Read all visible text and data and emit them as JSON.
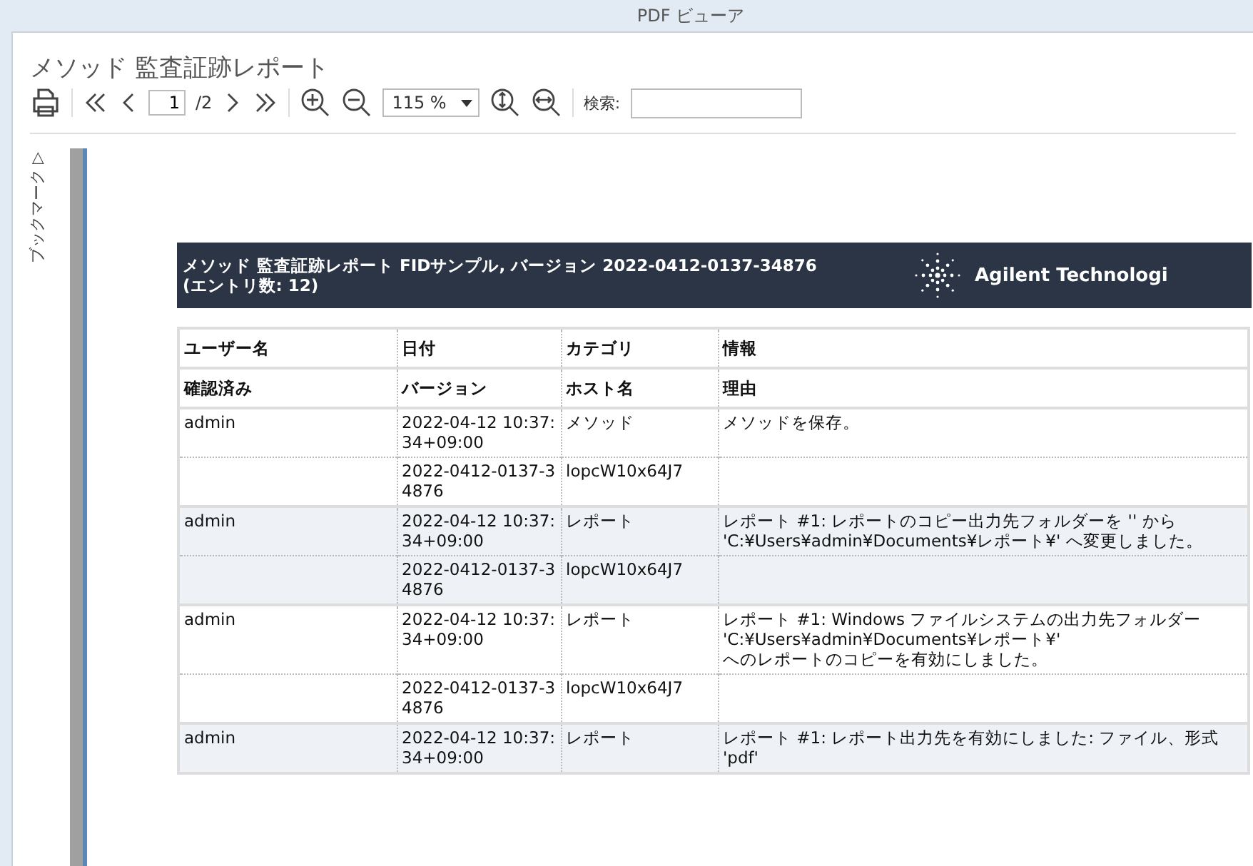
{
  "window": {
    "title": "PDF ビューア"
  },
  "document_title": "メソッド 監査証跡レポート",
  "toolbar": {
    "page_value": "1",
    "page_total": "/2",
    "zoom": "115 %",
    "search_label": "検索:"
  },
  "sidebar": {
    "label": "ブックマーク ▷"
  },
  "report": {
    "header": "メソッド 監査証跡レポート FIDサンプル, バージョン 2022-0412-0137-34876\n(エントリ数: 12)",
    "logo_text": "Agilent Technologi",
    "columns": [
      [
        "ユーザー名",
        "日付",
        "カテゴリ",
        "情報"
      ],
      [
        "確認済み",
        "バージョン",
        "ホスト名",
        "理由"
      ]
    ],
    "entries": [
      {
        "user": "admin",
        "date": "2022-04-12 10:37:34+09:00",
        "category": "メソッド",
        "info": "メソッドを保存。",
        "version": "2022-0412-0137-34876",
        "host": "lopcW10x64J7"
      },
      {
        "user": "admin",
        "date": "2022-04-12 10:37:34+09:00",
        "category": "レポート",
        "info": "レポート #1: レポートのコピー出力先フォルダーを '' から\n'C:¥Users¥admin¥Documents¥レポート¥' へ変更しました。",
        "version": "2022-0412-0137-34876",
        "host": "lopcW10x64J7"
      },
      {
        "user": "admin",
        "date": "2022-04-12 10:37:34+09:00",
        "category": "レポート",
        "info": "レポート #1: Windows ファイルシステムの出力先フォルダー\n'C:¥Users¥admin¥Documents¥レポート¥'\nへのレポートのコピーを有効にしました。",
        "version": "2022-0412-0137-34876",
        "host": "lopcW10x64J7"
      },
      {
        "user": "admin",
        "date": "2022-04-12 10:37:34+09:00",
        "category": "レポート",
        "info": "レポート #1: レポート出力先を有効にしました: ファイル、形式 'pdf'"
      }
    ]
  }
}
